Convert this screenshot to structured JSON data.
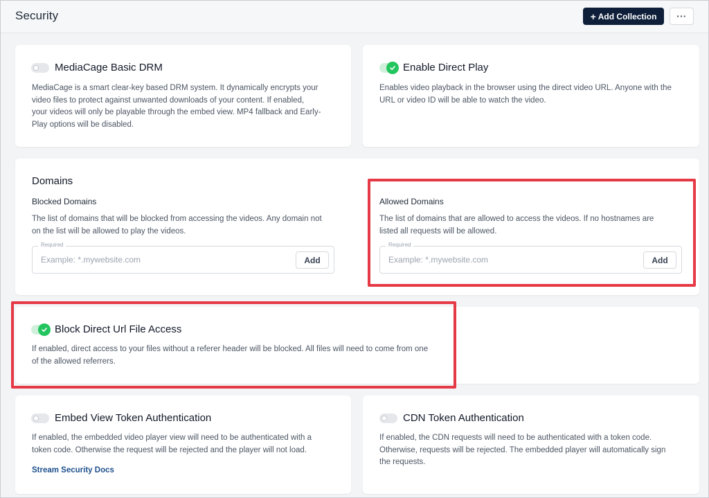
{
  "header": {
    "title": "Security",
    "add_collection_label": "Add Collection",
    "add_collection_icon": "+",
    "more_label": "···"
  },
  "cards": {
    "drm": {
      "title": "MediaCage Basic DRM",
      "enabled": false,
      "description_lines": [
        "MediaCage is a smart clear-key based DRM system. It dynamically encrypts your",
        "video files to protect against unwanted downloads of your content. If enabled,",
        "your videos will only be playable through the embed view. MP4 fallback and Early-",
        "Play options will be disabled."
      ]
    },
    "direct_play": {
      "title": "Enable Direct Play",
      "enabled": true,
      "description_lines": [
        "Enables video playback in the browser using the direct video URL. Anyone with the",
        "URL or video ID will be able to watch the video."
      ]
    },
    "domains": {
      "title": "Domains",
      "blocked": {
        "title": "Blocked Domains",
        "description_lines": [
          "The list of domains that will be blocked from accessing the videos. Any domain not",
          "on the list will be allowed to play the videos."
        ],
        "input_label": "Required",
        "placeholder": "Example: *.mywebsite.com",
        "add_label": "Add"
      },
      "allowed": {
        "title": "Allowed Domains",
        "description_lines": [
          "The list of domains that are allowed to access the videos. If no hostnames are",
          "listed all requests will be allowed."
        ],
        "input_label": "Required",
        "placeholder": "Example: *.mywebsite.com",
        "add_label": "Add"
      }
    },
    "block_direct": {
      "title": "Block Direct Url File Access",
      "enabled": true,
      "description_lines": [
        "If enabled, direct access to your files without a referer header will be blocked. All files will need to come from one",
        "of the allowed referrers."
      ]
    },
    "embed_token": {
      "title": "Embed View Token Authentication",
      "enabled": false,
      "description_lines": [
        "If enabled, the embedded video player view will need to be authenticated with a",
        "token code. Otherwise the request will be rejected and the player will not load."
      ],
      "link_label": "Stream Security Docs"
    },
    "cdn_token": {
      "title": "CDN Token Authentication",
      "enabled": false,
      "description_lines": [
        "If enabled, the CDN requests will need to be authenticated with a token code.",
        "Otherwise, requests will be rejected. The embedded player will automatically sign",
        "the requests."
      ]
    }
  },
  "colors": {
    "primary_button": "#0f1f3a",
    "toggle_on": "#22c55e",
    "highlight": "#e63946",
    "link": "#1d4f8c"
  },
  "icons": {
    "check": "check-icon",
    "more": "ellipsis-icon"
  }
}
